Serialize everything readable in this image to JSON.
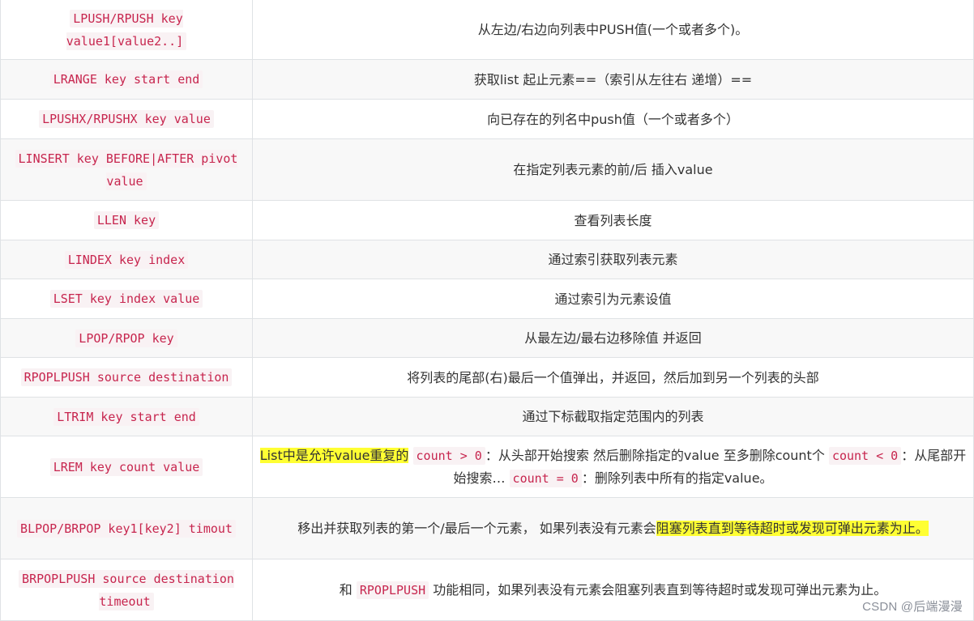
{
  "rows": [
    {
      "cmd": "LPUSH/RPUSH key value1[value2..]",
      "desc": "从左边/右边向列表中PUSH值(一个或者多个)。"
    },
    {
      "cmd": "LRANGE key start end",
      "desc": "获取list 起止元素==（索引从左往右 递增）=="
    },
    {
      "cmd": "LPUSHX/RPUSHX key value",
      "desc": "向已存在的列名中push值（一个或者多个）"
    },
    {
      "cmd": "LINSERT key BEFORE|AFTER pivot value",
      "desc": "在指定列表元素的前/后 插入value"
    },
    {
      "cmd": "LLEN key",
      "desc": "查看列表长度"
    },
    {
      "cmd": "LINDEX key index",
      "desc": "通过索引获取列表元素"
    },
    {
      "cmd": "LSET key index value",
      "desc": "通过索引为元素设值"
    },
    {
      "cmd": "LPOP/RPOP key",
      "desc": "从最左边/最右边移除值 并返回"
    },
    {
      "cmd": "RPOPLPUSH source destination",
      "desc": "将列表的尾部(右)最后一个值弹出，并返回，然后加到另一个列表的头部"
    },
    {
      "cmd": "LTRIM key start end",
      "desc": "通过下标截取指定范围内的列表"
    },
    {
      "cmd": "LREM key count value",
      "desc_parts": {
        "hl": "List中是允许value重复的",
        "code1": "count > 0",
        "t1": "：从头部开始搜索 然后删除指定的value 至多删除count个",
        "code2": "count < 0",
        "t2": "：从尾部开始搜索…",
        "code3": "count = 0",
        "t3": "：删除列表中所有的指定value。"
      }
    },
    {
      "cmd": "BLPOP/BRPOP key1[key2] timout",
      "desc_parts": {
        "t1": "移出并获取列表的第一个/最后一个元素， 如果列表没有元素会",
        "hl": "阻塞列表直到等待超时或发现可弹出元素为止。"
      }
    },
    {
      "cmd": "BRPOPLPUSH source destination timeout",
      "desc_parts": {
        "t1": "和",
        "code1": "RPOPLPUSH",
        "t2": "功能相同，如果列表没有元素会阻塞列表直到等待超时或发现可弹出元素为止。"
      }
    }
  ],
  "watermark": "CSDN @后端漫漫"
}
